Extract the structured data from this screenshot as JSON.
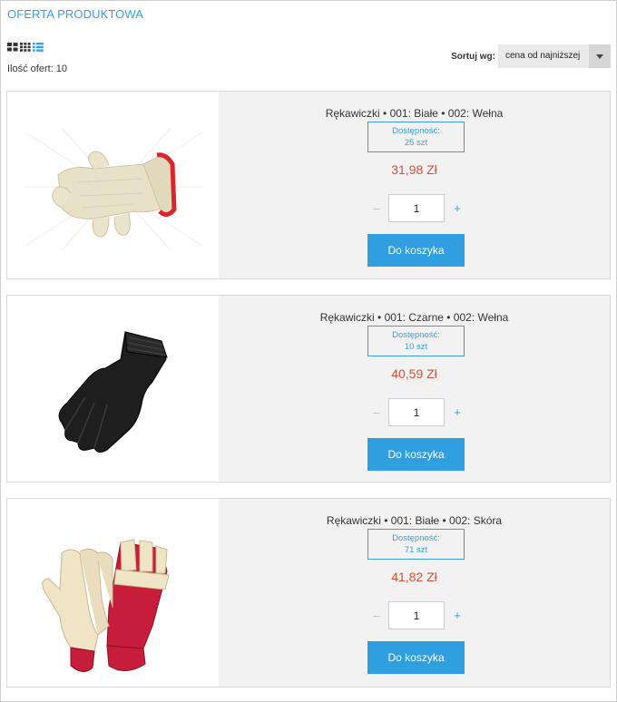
{
  "header": {
    "title": "OFERTA PRODUKTOWA",
    "count_label": "Ilość ofert:",
    "count_value": "10",
    "sort_label": "Sortuj wg:",
    "sort_value": "cena od najniższej"
  },
  "view_icons": [
    "grid-large-icon",
    "grid-small-icon",
    "list-icon"
  ],
  "colors": {
    "accent": "#3aa0dc",
    "price": "#d9503a",
    "button": "#2f9fe0",
    "card_bg": "#f2f2f2"
  },
  "products": [
    {
      "name": "Rękawiczki • 001: Białe • 002: Wełna",
      "avail_label": "Dostępność:",
      "avail_value": "25 szt",
      "price": "31,98 Zł",
      "qty": "1",
      "minus": "–",
      "plus": "+",
      "button": "Do koszyka",
      "image": "white-knit-gloves"
    },
    {
      "name": "Rękawiczki • 001: Czarne • 002: Wełna",
      "avail_label": "Dostępność:",
      "avail_value": "10 szt",
      "price": "40,59 Zł",
      "qty": "1",
      "minus": "–",
      "plus": "+",
      "button": "Do koszyka",
      "image": "black-knit-glove"
    },
    {
      "name": "Rękawiczki • 001: Białe • 002: Skóra",
      "avail_label": "Dostępność:",
      "avail_value": "71 szt",
      "price": "41,82 Zł",
      "qty": "1",
      "minus": "–",
      "plus": "+",
      "button": "Do koszyka",
      "image": "leather-work-gloves"
    }
  ]
}
